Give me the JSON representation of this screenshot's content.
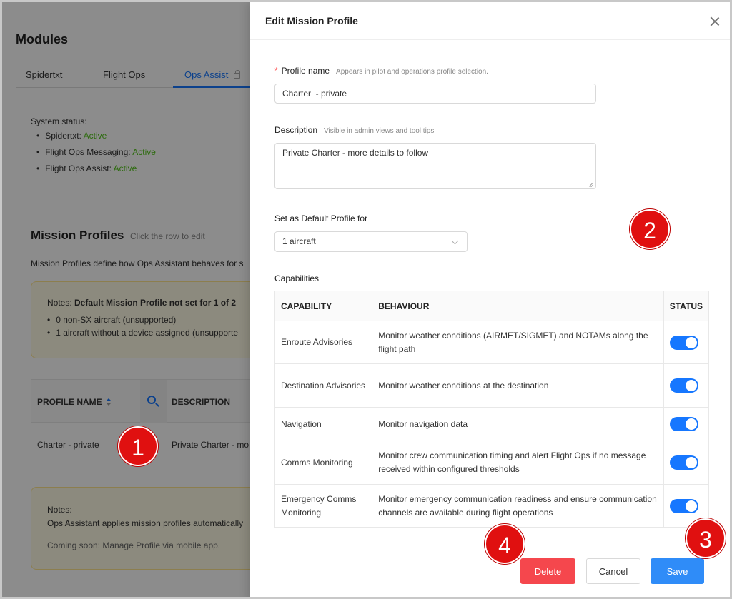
{
  "background": {
    "title": "Modules",
    "tabs": [
      "Spidertxt",
      "Flight Ops",
      "Ops Assist"
    ],
    "status_title": "System status:",
    "statuses": [
      {
        "name": "Spidertxt:",
        "value": "Active"
      },
      {
        "name": "Flight Ops Messaging:",
        "value": "Active"
      },
      {
        "name": "Flight Ops Assist:",
        "value": "Active"
      }
    ],
    "mission_title": "Mission Profiles",
    "mission_hint": "Click the row to edit",
    "mission_desc": "Mission Profiles define how Ops Assistant behaves for s",
    "note_prefix": "Notes: ",
    "note_bold": "Default Mission Profile not set for 1 of 2",
    "note_items": [
      "0 non-SX aircraft (unsupported)",
      "1 aircraft without a device assigned (unsupporte"
    ],
    "table_headers": {
      "name": "PROFILE NAME",
      "description": "DESCRIPTION"
    },
    "table_row": {
      "name": "Charter - private",
      "description": "Private Charter - mo"
    },
    "notes2_title": "Notes:",
    "notes2_text": "Ops Assistant applies mission profiles automatically",
    "notes2_soon": "Coming soon: Manage Profile via mobile app."
  },
  "drawer": {
    "title": "Edit Mission Profile",
    "profile_name_label": "Profile name",
    "profile_name_required": "*",
    "profile_name_help": "Appears in pilot and operations profile selection.",
    "profile_name_value": "Charter  - private",
    "description_label": "Description",
    "description_help": "Visible in admin views and tool tips",
    "description_value": "Private Charter - more details to follow",
    "default_label": "Set as Default Profile for",
    "default_value": "1 aircraft",
    "capabilities_label": "Capabilities",
    "cap_headers": {
      "capability": "CAPABILITY",
      "behaviour": "BEHAVIOUR",
      "status": "STATUS"
    },
    "capabilities": [
      {
        "capability": "Enroute Advisories",
        "behaviour": "Monitor weather conditions (AIRMET/SIGMET) and NOTAMs along the flight path",
        "enabled": true
      },
      {
        "capability": "Destination Advisories",
        "behaviour": "Monitor weather conditions at the destination",
        "enabled": true
      },
      {
        "capability": "Navigation",
        "behaviour": "Monitor navigation data",
        "enabled": true
      },
      {
        "capability": "Comms Monitoring",
        "behaviour": "Monitor crew communication timing and alert Flight Ops if no message received within configured thresholds",
        "enabled": true
      },
      {
        "capability": "Emergency Comms Monitoring",
        "behaviour": "Monitor emergency communication readiness and ensure communication channels are available during flight operations",
        "enabled": true
      }
    ],
    "buttons": {
      "delete": "Delete",
      "cancel": "Cancel",
      "save": "Save"
    }
  },
  "markers": [
    "1",
    "2",
    "3",
    "4"
  ],
  "colors": {
    "accent": "#1677ff",
    "delete": "#f5474d",
    "save": "#2f8cf8",
    "active": "#52c41a",
    "marker": "#e01010"
  }
}
